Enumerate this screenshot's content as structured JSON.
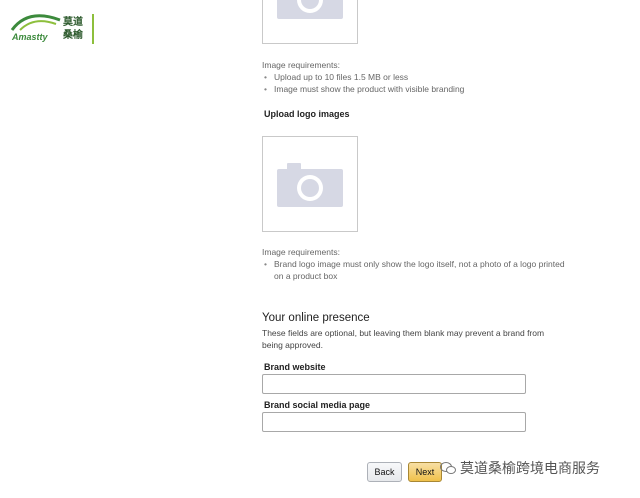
{
  "logo": {
    "text": "Amastty",
    "cn": "莫道桑榆"
  },
  "upload_images": {
    "requirements_label": "Image requirements:",
    "requirements": [
      "Upload up to 10 files 1.5 MB or less",
      "Image must show the product with visible branding"
    ]
  },
  "upload_logo": {
    "title": "Upload logo images",
    "requirements_label": "Image requirements:",
    "requirements": [
      "Brand logo image must only show the logo itself, not a photo of a logo printed on a product box"
    ]
  },
  "online_presence": {
    "heading": "Your online presence",
    "description": "These fields are optional, but leaving them blank may prevent a brand from being approved.",
    "brand_website_label": "Brand website",
    "brand_website_value": "",
    "social_label": "Brand social media page",
    "social_value": ""
  },
  "buttons": {
    "back": "Back",
    "next": "Next"
  },
  "watermark": "莫道桑榆跨境电商服务",
  "colors": {
    "next_button": "#f0c14b",
    "logo_green": "#8dbf3c"
  },
  "icons": [
    "camera-icon",
    "chat-icon"
  ]
}
